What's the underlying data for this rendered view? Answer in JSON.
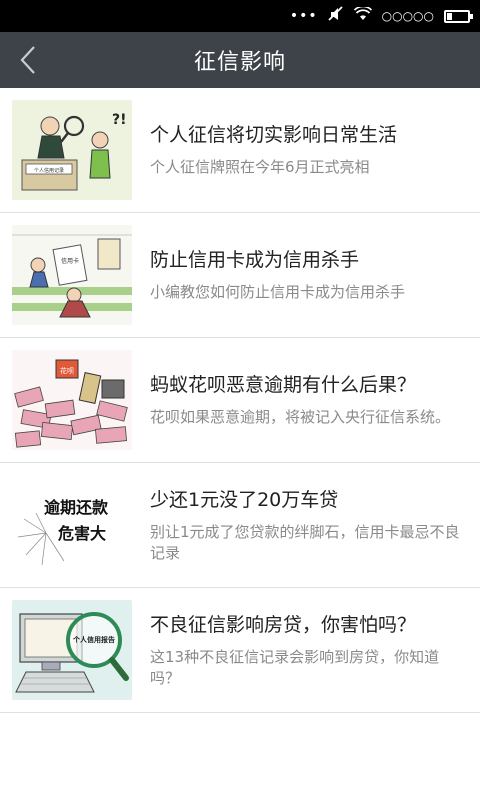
{
  "status_bar": {
    "signal": "○○○○○"
  },
  "nav": {
    "title": "征信影响"
  },
  "items": [
    {
      "title": "个人征信将切实影响日常生活",
      "desc": "个人征信牌照在今年6月正式亮相",
      "image": {
        "caption": "个人信用记录"
      }
    },
    {
      "title": "防止信用卡成为信用杀手",
      "desc": "小编教您如何防止信用卡成为信用杀手",
      "image": {
        "caption": "信用卡"
      }
    },
    {
      "title": "蚂蚁花呗恶意逾期有什么后果？",
      "desc": "花呗如果恶意逾期，将被记入央行征信系统。",
      "image": {
        "caption": "花呗"
      }
    },
    {
      "title": "少还1元没了20万车贷",
      "desc": "别让1元成了您贷款的绊脚石，信用卡最忌不良记录",
      "image": {
        "line1": "逾期还款",
        "line2": "危害大"
      }
    },
    {
      "title": "不良征信影响房贷，你害怕吗？",
      "desc": "这13种不良征信记录会影响到房贷，你知道吗？",
      "image": {
        "caption": "个人信用报告"
      }
    }
  ],
  "colors": {
    "nav_bg": "#3d4349",
    "status_bg": "#000000"
  }
}
